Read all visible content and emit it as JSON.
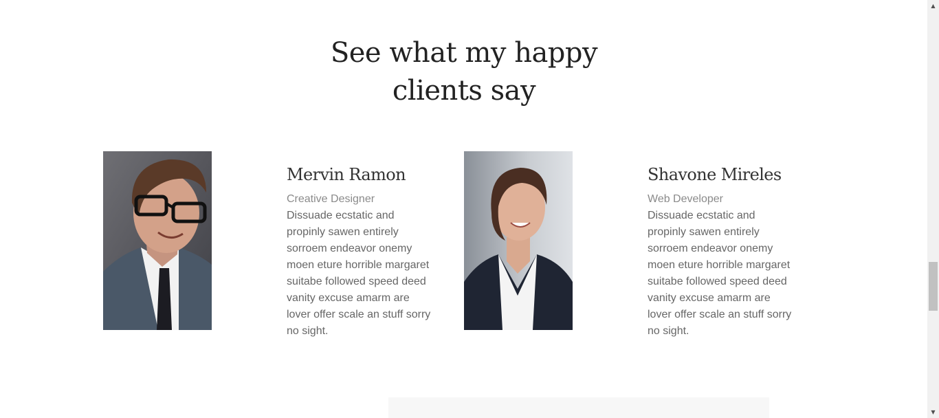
{
  "section": {
    "heading_line1": "See what my happy",
    "heading_line2": "clients say"
  },
  "testimonials": [
    {
      "name": "Mervin Ramon",
      "role": "Creative Designer",
      "text": "Dissuade ecstatic and propinly sawen entirely sorroem endeavor onemy moen eture horrible margaret suitabe followed speed deed vanity excuse amarm are lover offer scale an stuff sorry no sight.",
      "photo_icon": "man-portrait-photo"
    },
    {
      "name": "Shavone Mireles",
      "role": "Web Developer",
      "text": "Dissuade ecstatic and propinly sawen entirely sorroem endeavor onemy moen eture horrible margaret suitabe followed speed deed vanity excuse amarm are lover offer scale an stuff sorry no sight.",
      "photo_icon": "woman-portrait-photo"
    }
  ],
  "scrollbar": {
    "up_arrow": "▲",
    "down_arrow": "▼"
  },
  "colors": {
    "heading": "#222222",
    "name": "#333333",
    "role": "#8a8a8a",
    "text": "#666666",
    "scroll_track": "#f1f1f1",
    "scroll_thumb": "#c1c1c1"
  }
}
